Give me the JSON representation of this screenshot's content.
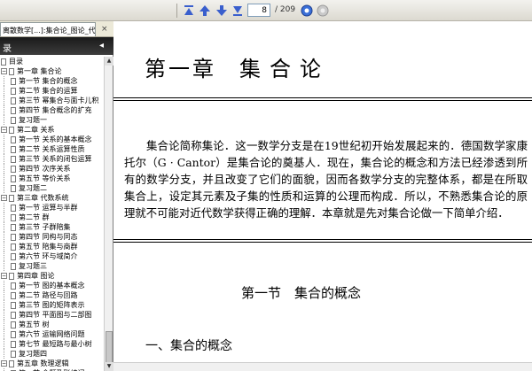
{
  "toolbar": {
    "page_current": "8",
    "page_total": "/ 209",
    "buttons": [
      "first-page",
      "prev-page",
      "next-page",
      "last-page",
      "go",
      "stop"
    ]
  },
  "sidebar": {
    "doc_tab_label": "离散数学[...]:集合论_图论_代数系统_...",
    "close_glyph": "×",
    "header": "录",
    "header_arrow": "◂",
    "items": [
      {
        "label": "目录",
        "level": 0,
        "expander": ""
      },
      {
        "label": "第一章   集合论",
        "level": 0,
        "expander": "−"
      },
      {
        "label": "第一节   集合的概念",
        "level": 1,
        "expander": ""
      },
      {
        "label": "第二节   集合的运算",
        "level": 1,
        "expander": ""
      },
      {
        "label": "第三节   幂集合与面卡儿积",
        "level": 1,
        "expander": ""
      },
      {
        "label": "第四节   集合概念的扩充",
        "level": 1,
        "expander": ""
      },
      {
        "label": "复习题一",
        "level": 1,
        "expander": ""
      },
      {
        "label": "第二章   关系",
        "level": 0,
        "expander": "−"
      },
      {
        "label": "第一节   关系的基本概念",
        "level": 1,
        "expander": ""
      },
      {
        "label": "第二节   关系运算性质",
        "level": 1,
        "expander": ""
      },
      {
        "label": "第三节   关系的闭包运算",
        "level": 1,
        "expander": ""
      },
      {
        "label": "第四节   次序关系",
        "level": 1,
        "expander": ""
      },
      {
        "label": "第五节   等价关系",
        "level": 1,
        "expander": ""
      },
      {
        "label": "复习题二",
        "level": 1,
        "expander": ""
      },
      {
        "label": "第三章   代数系统",
        "level": 0,
        "expander": "−"
      },
      {
        "label": "第一节   运算与半群",
        "level": 1,
        "expander": ""
      },
      {
        "label": "第二节   群",
        "level": 1,
        "expander": ""
      },
      {
        "label": "第三节   子群陪集",
        "level": 1,
        "expander": ""
      },
      {
        "label": "第四节   同构与同态",
        "level": 1,
        "expander": ""
      },
      {
        "label": "第五节   陪集与商群",
        "level": 1,
        "expander": ""
      },
      {
        "label": "第六节   环与域简介",
        "level": 1,
        "expander": ""
      },
      {
        "label": "复习题三",
        "level": 1,
        "expander": ""
      },
      {
        "label": "第四章   图论",
        "level": 0,
        "expander": "−"
      },
      {
        "label": "第一节   图的基本概念",
        "level": 1,
        "expander": ""
      },
      {
        "label": "第二节   路径与回路",
        "level": 1,
        "expander": ""
      },
      {
        "label": "第三节   图的矩阵表示",
        "level": 1,
        "expander": ""
      },
      {
        "label": "第四节   平面图与二部图",
        "level": 1,
        "expander": ""
      },
      {
        "label": "第五节   树",
        "level": 1,
        "expander": ""
      },
      {
        "label": "第六节   运输网络问题",
        "level": 1,
        "expander": ""
      },
      {
        "label": "第七节   最短路与最小树",
        "level": 1,
        "expander": ""
      },
      {
        "label": "复习题四",
        "level": 1,
        "expander": ""
      },
      {
        "label": "第五章   数理逻辑",
        "level": 0,
        "expander": "−"
      },
      {
        "label": "第一节   命题及联结词",
        "level": 1,
        "expander": ""
      },
      {
        "label": "第二节   命题公式与翻译",
        "level": 1,
        "expander": ""
      }
    ]
  },
  "document": {
    "chapter_label": "第一章",
    "chapter_name": "集合论",
    "paragraph": "集合论简称集论．这一数学分支是在19世纪初开始发展起来的．德国数学家康托尔（G · Cantor）是集合论的奠基人．现在，集合论的概念和方法已经渗透到所有的数学分支，并且改变了它们的面貌，因而各数学分支的完整体系，都是在所取集合上，设定其元素及子集的性质和运算的公理而构成．所以，不熟悉集合论的原理就不可能对近代数学获得正确的理解．本章就是先对集合论做一下简单介绍．",
    "section_title": "第一节　集合的概念",
    "subsection_title": "一、集合的概念"
  },
  "colors": {
    "toolbar_icon": "#3a5fcd",
    "panel_header": "#1a1a1a",
    "doc_bg": "#ffffff"
  }
}
